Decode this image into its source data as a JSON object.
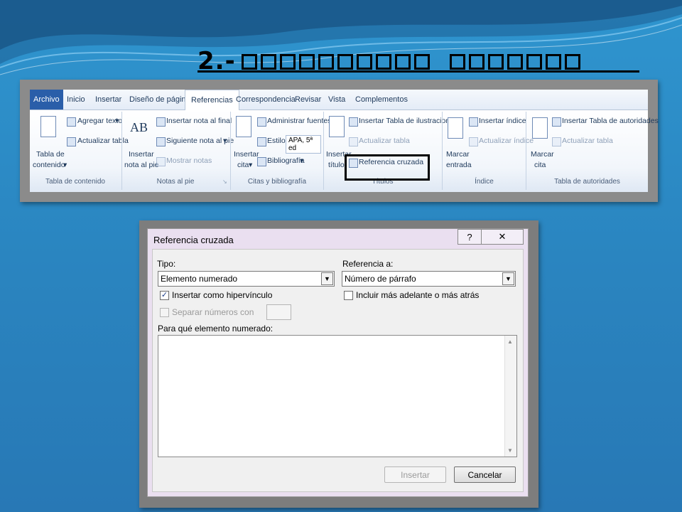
{
  "slide": {
    "title_prefix": "2.-",
    "colors": {
      "background": "#2a85c0",
      "title": "#000000"
    }
  },
  "ribbon": {
    "tabs": [
      "Archivo",
      "Inicio",
      "Insertar",
      "Diseño de página",
      "Referencias",
      "Correspondencia",
      "Revisar",
      "Vista",
      "Complementos"
    ],
    "active_tab": "Referencias",
    "groups": {
      "tabla_contenido": {
        "label": "Tabla de contenido",
        "big_button_line1": "Tabla de",
        "big_button_line2": "contenido",
        "agregar_texto": "Agregar texto",
        "actualizar_tabla": "Actualizar tabla"
      },
      "notas_pie": {
        "label": "Notas al pie",
        "big_icon_text": "AB",
        "big_button_line1": "Insertar",
        "big_button_line2": "nota al pie",
        "insertar_nota_final": "Insertar nota al final",
        "siguiente_nota": "Siguiente nota al pie",
        "mostrar_notas": "Mostrar notas"
      },
      "citas": {
        "label": "Citas y bibliografía",
        "big_button_line1": "Insertar",
        "big_button_line2": "cita",
        "administrar_fuentes": "Administrar fuentes",
        "estilo_label": "Estilo:",
        "estilo_value": "APA, 5ª ed",
        "bibliografia": "Bibliografía"
      },
      "titulos": {
        "label": "Títulos",
        "big_button_line1": "Insertar",
        "big_button_line2": "título",
        "insertar_tabla_ilustraciones": "Insertar Tabla de ilustraciones",
        "actualizar_tabla": "Actualizar tabla",
        "referencia_cruzada": "Referencia cruzada"
      },
      "indice": {
        "label": "Índice",
        "big_button_line1": "Marcar",
        "big_button_line2": "entrada",
        "insertar_indice": "Insertar índice",
        "actualizar_indice": "Actualizar índice"
      },
      "autoridades": {
        "label": "Tabla de autoridades",
        "big_button_line1": "Marcar",
        "big_button_line2": "cita",
        "insertar_tabla_autoridades": "Insertar Tabla de autoridades",
        "actualizar_tabla": "Actualizar tabla"
      }
    }
  },
  "dialog": {
    "title": "Referencia cruzada",
    "help": "?",
    "close": "✕",
    "tipo_label": "Tipo:",
    "tipo_value": "Elemento numerado",
    "referencia_label": "Referencia a:",
    "referencia_value": "Número de párrafo",
    "hipervinculo_label": "Insertar como hipervínculo",
    "hipervinculo_checked": true,
    "incluir_label": "Incluir más adelante o más atrás",
    "incluir_checked": false,
    "separar_label": "Separar números con",
    "lista_label": "Para qué elemento numerado:",
    "insertar_button": "Insertar",
    "cancelar_button": "Cancelar"
  }
}
